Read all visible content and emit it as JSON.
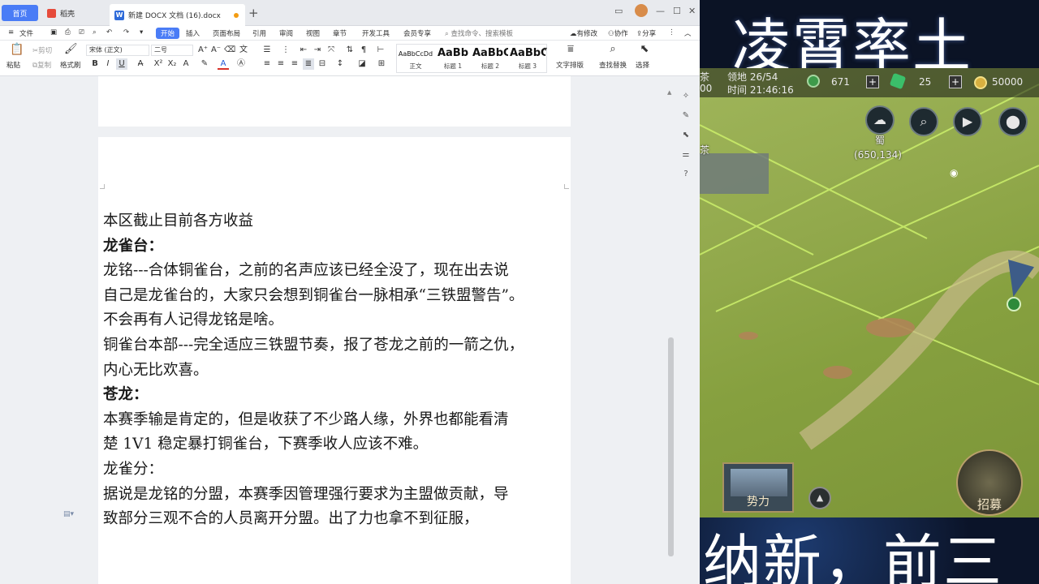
{
  "tabs": {
    "home": "首页",
    "shell": "稻壳",
    "doc": "新建 DOCX 文档 (16).docx",
    "new_tab": "+"
  },
  "window_controls": {
    "min": "—",
    "restore": "☐",
    "close": "✕"
  },
  "menu": {
    "file": "文件",
    "items": [
      "开始",
      "插入",
      "页面布局",
      "引用",
      "审阅",
      "视图",
      "章节",
      "开发工具",
      "会员专享"
    ],
    "search": "查找命令、搜索模板",
    "right": [
      "有修改",
      "协作",
      "分享"
    ]
  },
  "ribbon": {
    "paste": "粘贴",
    "cut": "剪切",
    "copy": "复制",
    "format_painter": "格式刷",
    "font_name": "宋体 (正文)",
    "font_size": "二号",
    "styles": [
      {
        "sample": "AaBbCcDd",
        "label": "正文"
      },
      {
        "sample": "AaBb",
        "label": "标题 1"
      },
      {
        "sample": "AaBbC",
        "label": "标题 2"
      },
      {
        "sample": "AaBbCc",
        "label": "标题 3"
      }
    ],
    "text_layout": "文字排版",
    "find_replace": "查找替换",
    "select": "选择"
  },
  "document": {
    "lines": [
      {
        "text": "本区截止目前各方收益",
        "bold": false
      },
      {
        "text": "龙雀台：",
        "bold": true
      },
      {
        "text": "龙铭---合体铜雀台，之前的名声应该已经全没了，现在出去说",
        "bold": false
      },
      {
        "text": "自己是龙雀台的，大家只会想到铜雀台一脉相承“三铁盟警告”。",
        "bold": false
      },
      {
        "text": "不会再有人记得龙铭是啥。",
        "bold": false
      },
      {
        "text": "铜雀台本部---完全适应三铁盟节奏，报了苍龙之前的一箭之仇，",
        "bold": false
      },
      {
        "text": "内心无比欢喜。",
        "bold": false
      },
      {
        "text": "苍龙：",
        "bold": true
      },
      {
        "text": "本赛季输是肯定的，但是收获了不少路人缘，外界也都能看清",
        "bold": false
      },
      {
        "text": "楚 1V1 稳定暴打铜雀台，下赛季收人应该不难。",
        "bold": false
      },
      {
        "text": "龙雀分：",
        "bold": false
      },
      {
        "text": "据说是龙铭的分盟，本赛季因管理强行要求为主盟做贡献，导",
        "bold": false
      },
      {
        "text": "致部分三观不合的人员离开分盟。出了力也拿不到征服，",
        "bold": false
      }
    ]
  },
  "game": {
    "banner_top": "凌霄率土",
    "banner_bottom": "纳新，前三",
    "hud": {
      "left_partial_1": "茶",
      "left_partial_2": "00",
      "territory": "领地 26/54",
      "time": "时间 21:46:16",
      "jade": "671",
      "tokens": "25",
      "copper": "50000"
    },
    "state_label": "蜀",
    "coords": "(650,134)",
    "map_edge_label": "茶",
    "faction_button": "势力",
    "recruit_button": "招募",
    "colors": {
      "accent": "#4a7cf6",
      "hud_bg": "#141814",
      "map_green": "#92a94c"
    }
  }
}
